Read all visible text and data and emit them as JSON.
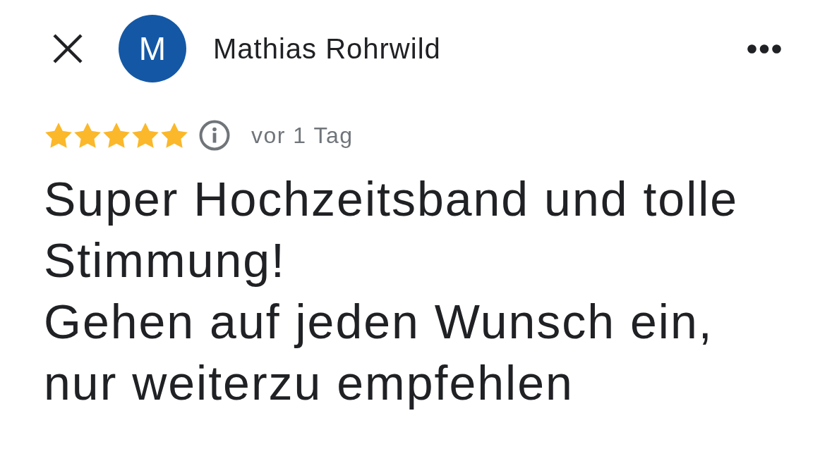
{
  "header": {
    "avatar_initial": "M",
    "reviewer_name": "Mathias Rohrwild"
  },
  "rating": {
    "stars": 5,
    "time": "vor 1 Tag"
  },
  "review": {
    "text": "Super Hochzeitsband und tolle Stimmung!\nGehen auf jeden Wunsch ein,\nnur weiterzu empfehlen"
  }
}
